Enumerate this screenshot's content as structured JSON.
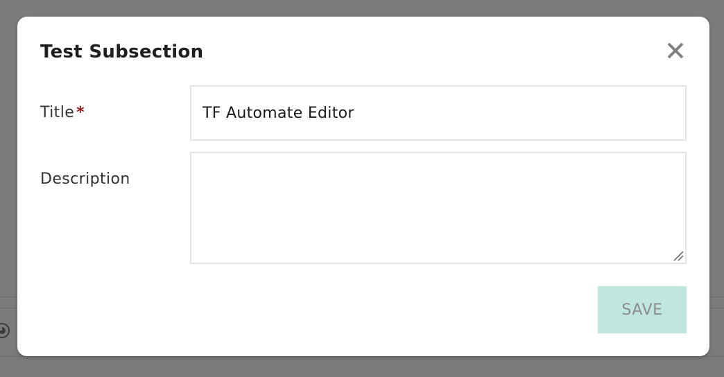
{
  "dialog": {
    "title": "Test Subsection",
    "close_icon": "close-icon",
    "fields": {
      "title": {
        "label": "Title",
        "required_mark": "*",
        "value": "TF Automate Editor"
      },
      "description": {
        "label": "Description",
        "value": ""
      }
    },
    "save_label": "SAVE"
  },
  "colors": {
    "overlay": "#7b7b7b",
    "required": "#9b1c1c",
    "save_button_bg": "#bfe7df",
    "save_button_text": "#8c8c8c",
    "close_icon": "#808080"
  }
}
